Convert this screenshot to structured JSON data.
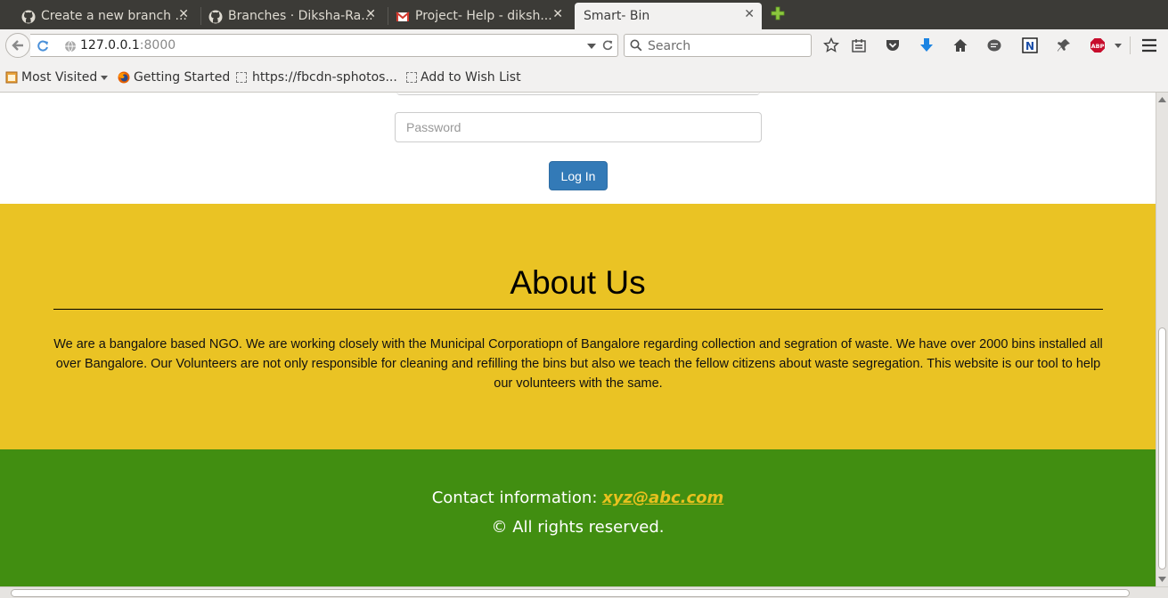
{
  "browser": {
    "tabs": [
      {
        "title": "Create a new branch ...",
        "icon": "github-icon"
      },
      {
        "title": "Branches · Diksha-Ra...",
        "icon": "github-icon"
      },
      {
        "title": "Project- Help - diksh...",
        "icon": "gmail-icon"
      },
      {
        "title": "Smart- Bin",
        "icon": "none"
      }
    ],
    "tab_close": "✕",
    "url_host": "127.0.0.1",
    "url_port": ":8000",
    "search_placeholder": "Search",
    "bookmarks": [
      {
        "label": "Most Visited",
        "icon": "most-visited-icon"
      },
      {
        "label": "Getting Started",
        "icon": "firefox-icon"
      },
      {
        "label": "https://fbcdn-sphotos...",
        "icon": "page-icon"
      },
      {
        "label": "Add to Wish List",
        "icon": "page-icon"
      }
    ],
    "toolbar_icons": [
      "bookmark-star-icon",
      "reading-list-icon",
      "pocket-icon",
      "downloads-icon",
      "home-icon",
      "chat-icon",
      "evernote-icon",
      "pin-icon",
      "adblock-icon",
      "menu-icon"
    ],
    "adblock_label": "ABP",
    "colors": {
      "tabstrip": "#3c3b37",
      "chrome": "#f2f1f0"
    }
  },
  "page": {
    "login": {
      "password_placeholder": "Password",
      "login_label": "Log In"
    },
    "about": {
      "heading": "About Us",
      "text": "We are a bangalore based NGO. We are working closely with the Municipal Corporatiopn of Bangalore regarding collection and segration of waste. We have over 2000 bins installed all over Bangalore. Our Volunteers are not only responsible for cleaning and refilling the bins but also we teach the fellow citizens about waste segregation. This website is our tool to help our volunteers with the same."
    },
    "footer": {
      "contact_label": "Contact information: ",
      "contact_email": "xyz@abc.com",
      "rights": "© All rights reserved."
    },
    "colors": {
      "primary": "#337ab7",
      "about_bg": "#eac324",
      "footer_bg": "#418e11",
      "link": "#e8c11e"
    }
  }
}
